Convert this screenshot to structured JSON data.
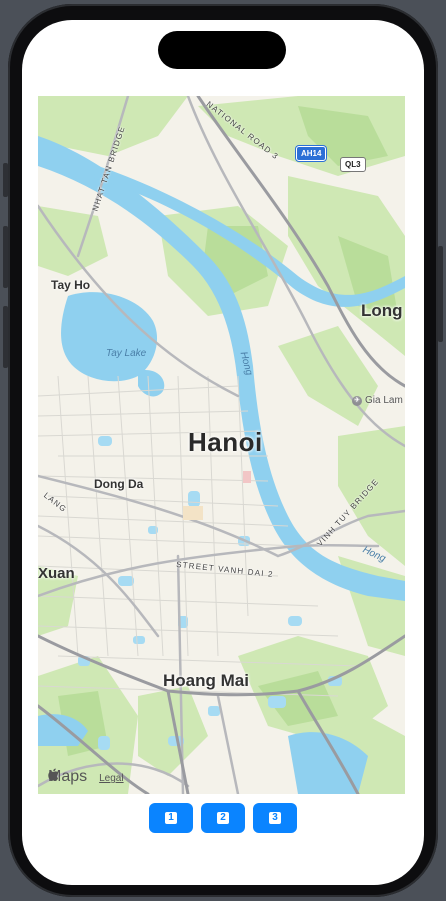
{
  "map": {
    "city": "Hanoi",
    "districts": [
      "Tay Ho",
      "Dong Da",
      "Hoang Mai",
      "Long",
      "Xuan"
    ],
    "water": [
      "Tay Lake",
      "Hong",
      "Hong"
    ],
    "roads": [
      "NATIONAL ROAD 3",
      "NHAT TAN BRIDGE",
      "VINH TUY BRIDGE",
      "STREET VANH DAI 2",
      "LANG"
    ],
    "shields": [
      "AH14",
      "QL3"
    ],
    "poi": "Gia Lam",
    "attribution": {
      "logo": "Maps",
      "legal": "Legal"
    },
    "colors": {
      "water": "#8fd0ef",
      "park": "#cfe8b4",
      "land": "#f4f2ea",
      "highway": "#9a9ba0"
    }
  },
  "buttons": [
    {
      "label": "1"
    },
    {
      "label": "2"
    },
    {
      "label": "3"
    }
  ],
  "accent": "#0a84ff"
}
